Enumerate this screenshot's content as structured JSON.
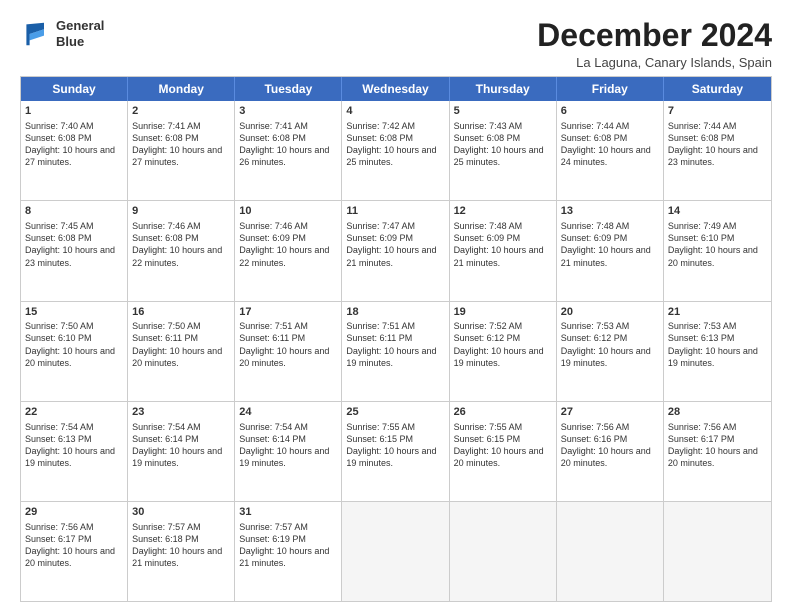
{
  "logo": {
    "line1": "General",
    "line2": "Blue"
  },
  "title": "December 2024",
  "location": "La Laguna, Canary Islands, Spain",
  "days_of_week": [
    "Sunday",
    "Monday",
    "Tuesday",
    "Wednesday",
    "Thursday",
    "Friday",
    "Saturday"
  ],
  "weeks": [
    [
      {
        "day": "1",
        "rise": "7:40 AM",
        "set": "6:08 PM",
        "daylight": "10 hours and 27 minutes."
      },
      {
        "day": "2",
        "rise": "7:41 AM",
        "set": "6:08 PM",
        "daylight": "10 hours and 27 minutes."
      },
      {
        "day": "3",
        "rise": "7:41 AM",
        "set": "6:08 PM",
        "daylight": "10 hours and 26 minutes."
      },
      {
        "day": "4",
        "rise": "7:42 AM",
        "set": "6:08 PM",
        "daylight": "10 hours and 25 minutes."
      },
      {
        "day": "5",
        "rise": "7:43 AM",
        "set": "6:08 PM",
        "daylight": "10 hours and 25 minutes."
      },
      {
        "day": "6",
        "rise": "7:44 AM",
        "set": "6:08 PM",
        "daylight": "10 hours and 24 minutes."
      },
      {
        "day": "7",
        "rise": "7:44 AM",
        "set": "6:08 PM",
        "daylight": "10 hours and 23 minutes."
      }
    ],
    [
      {
        "day": "8",
        "rise": "7:45 AM",
        "set": "6:08 PM",
        "daylight": "10 hours and 23 minutes."
      },
      {
        "day": "9",
        "rise": "7:46 AM",
        "set": "6:08 PM",
        "daylight": "10 hours and 22 minutes."
      },
      {
        "day": "10",
        "rise": "7:46 AM",
        "set": "6:09 PM",
        "daylight": "10 hours and 22 minutes."
      },
      {
        "day": "11",
        "rise": "7:47 AM",
        "set": "6:09 PM",
        "daylight": "10 hours and 21 minutes."
      },
      {
        "day": "12",
        "rise": "7:48 AM",
        "set": "6:09 PM",
        "daylight": "10 hours and 21 minutes."
      },
      {
        "day": "13",
        "rise": "7:48 AM",
        "set": "6:09 PM",
        "daylight": "10 hours and 21 minutes."
      },
      {
        "day": "14",
        "rise": "7:49 AM",
        "set": "6:10 PM",
        "daylight": "10 hours and 20 minutes."
      }
    ],
    [
      {
        "day": "15",
        "rise": "7:50 AM",
        "set": "6:10 PM",
        "daylight": "10 hours and 20 minutes."
      },
      {
        "day": "16",
        "rise": "7:50 AM",
        "set": "6:11 PM",
        "daylight": "10 hours and 20 minutes."
      },
      {
        "day": "17",
        "rise": "7:51 AM",
        "set": "6:11 PM",
        "daylight": "10 hours and 20 minutes."
      },
      {
        "day": "18",
        "rise": "7:51 AM",
        "set": "6:11 PM",
        "daylight": "10 hours and 19 minutes."
      },
      {
        "day": "19",
        "rise": "7:52 AM",
        "set": "6:12 PM",
        "daylight": "10 hours and 19 minutes."
      },
      {
        "day": "20",
        "rise": "7:53 AM",
        "set": "6:12 PM",
        "daylight": "10 hours and 19 minutes."
      },
      {
        "day": "21",
        "rise": "7:53 AM",
        "set": "6:13 PM",
        "daylight": "10 hours and 19 minutes."
      }
    ],
    [
      {
        "day": "22",
        "rise": "7:54 AM",
        "set": "6:13 PM",
        "daylight": "10 hours and 19 minutes."
      },
      {
        "day": "23",
        "rise": "7:54 AM",
        "set": "6:14 PM",
        "daylight": "10 hours and 19 minutes."
      },
      {
        "day": "24",
        "rise": "7:54 AM",
        "set": "6:14 PM",
        "daylight": "10 hours and 19 minutes."
      },
      {
        "day": "25",
        "rise": "7:55 AM",
        "set": "6:15 PM",
        "daylight": "10 hours and 19 minutes."
      },
      {
        "day": "26",
        "rise": "7:55 AM",
        "set": "6:15 PM",
        "daylight": "10 hours and 20 minutes."
      },
      {
        "day": "27",
        "rise": "7:56 AM",
        "set": "6:16 PM",
        "daylight": "10 hours and 20 minutes."
      },
      {
        "day": "28",
        "rise": "7:56 AM",
        "set": "6:17 PM",
        "daylight": "10 hours and 20 minutes."
      }
    ],
    [
      {
        "day": "29",
        "rise": "7:56 AM",
        "set": "6:17 PM",
        "daylight": "10 hours and 20 minutes."
      },
      {
        "day": "30",
        "rise": "7:57 AM",
        "set": "6:18 PM",
        "daylight": "10 hours and 21 minutes."
      },
      {
        "day": "31",
        "rise": "7:57 AM",
        "set": "6:19 PM",
        "daylight": "10 hours and 21 minutes."
      },
      null,
      null,
      null,
      null
    ]
  ]
}
